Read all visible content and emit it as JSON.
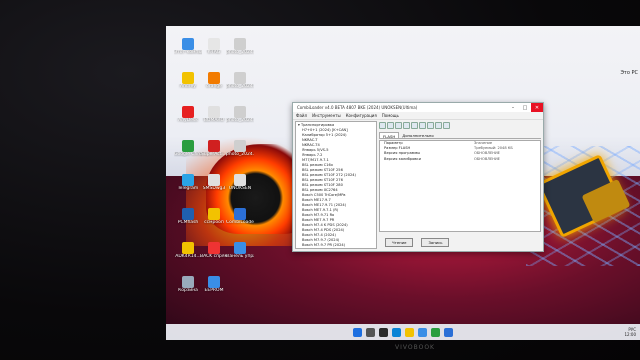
{
  "desktop": {
    "icons": [
      {
        "label": "Этот компьютер",
        "color": "#3a8ee6"
      },
      {
        "label": "K-TAG",
        "color": "#e6e6e6"
      },
      {
        "label": "photo_2024...",
        "color": "#cfcfcf"
      },
      {
        "label": "Andrey",
        "color": "#f2c200"
      },
      {
        "label": "orange",
        "color": "#f27b00"
      },
      {
        "label": "photo_2024...",
        "color": "#cfcfcf"
      },
      {
        "label": "AnyDesk",
        "color": "#e62020"
      },
      {
        "label": "BOMARO",
        "color": "#e0e0e0"
      },
      {
        "label": "photo_2024...",
        "color": "#cfcfcf"
      },
      {
        "label": "Google Chrome",
        "color": "#2a9d3f"
      },
      {
        "label": "SuperActi...",
        "color": "#d02020"
      },
      {
        "label": "photo_2024...",
        "color": "#cfcfcf"
      },
      {
        "label": "Telegram",
        "color": "#2aa3e6"
      },
      {
        "label": "SMSDwg3",
        "color": "#e0e0e0"
      },
      {
        "label": "UNOKSEN",
        "color": "#e0e0e0"
      },
      {
        "label": "PCMflash",
        "color": "#1f5fb0"
      },
      {
        "label": "ссмрооп",
        "color": "#f2c200"
      },
      {
        "label": "CombiLoader",
        "color": "#2b6fd6"
      },
      {
        "label": "ADK4R14...",
        "color": "#f2c200"
      },
      {
        "label": "BACK спрямов",
        "color": "#e33"
      },
      {
        "label": "Панель управления",
        "color": "#3a8ee6"
      },
      {
        "label": "Корзина",
        "color": "#9ab"
      },
      {
        "label": "EEPROM",
        "color": "#3a8ee6"
      }
    ],
    "right_label": "Это РС"
  },
  "window": {
    "title": "CombiLoader v4.0 BETA 4807 BKE (2024) UNOKSEN(Ultima)",
    "menu": [
      "Файл",
      "Инструменты",
      "Конфигурация",
      "Помощь"
    ],
    "tree": [
      "Транспортировка",
      "H7+0+1 (2024) [K+CAN]",
      "Калибратор 5+1 (2024)",
      "NKRAC-T",
      "NKRAC-T4",
      "Январь 5/VS-5",
      "Январь 7.2",
      "M77/M17.9.7.1",
      "BSL режим C16x",
      "BSL режим ST10F 256",
      "BSL режим ST10F 272 (2024)",
      "BSL режим ST10F 276",
      "BSL режим ST10F 280",
      "BSL режим XC2764",
      "Bosch C500 TriCore/MPa",
      "Bosch ME17.9.7",
      "Bosch ME17.9.71 (2024)",
      "Bosch ME7.9.7.1 (R)",
      "Bosch M7.9.71 Ro",
      "Bosch ME7.9.7 PR",
      "Bosch M7.4 K PDS (2024)",
      "Bosch M7.4 PDS (2024)",
      "Bosch M7.4 (2024)",
      "Bosch M7.9.7 (2024)",
      "Bosch M7.9.7 PR (2024)"
    ],
    "tabs": [
      "FLASH",
      "Дополнительно"
    ],
    "panel": {
      "rows": [
        {
          "k": "Параметр",
          "v": "Значение"
        },
        {
          "k": "Размер FLASH",
          "v": "Требуемый: 2048 КБ"
        },
        {
          "k": "Версия программы",
          "v": "ОБНОВЛЕНИЕ"
        },
        {
          "k": "Версия калибровки",
          "v": "ОБНОВЛЕНИЕ"
        }
      ]
    },
    "buttons": [
      "Чтение",
      "Запись"
    ]
  },
  "taskbar": {
    "tray_lang": "РУС",
    "tray_time": "12:00"
  },
  "bezel_brand": "VIVOBOOK"
}
